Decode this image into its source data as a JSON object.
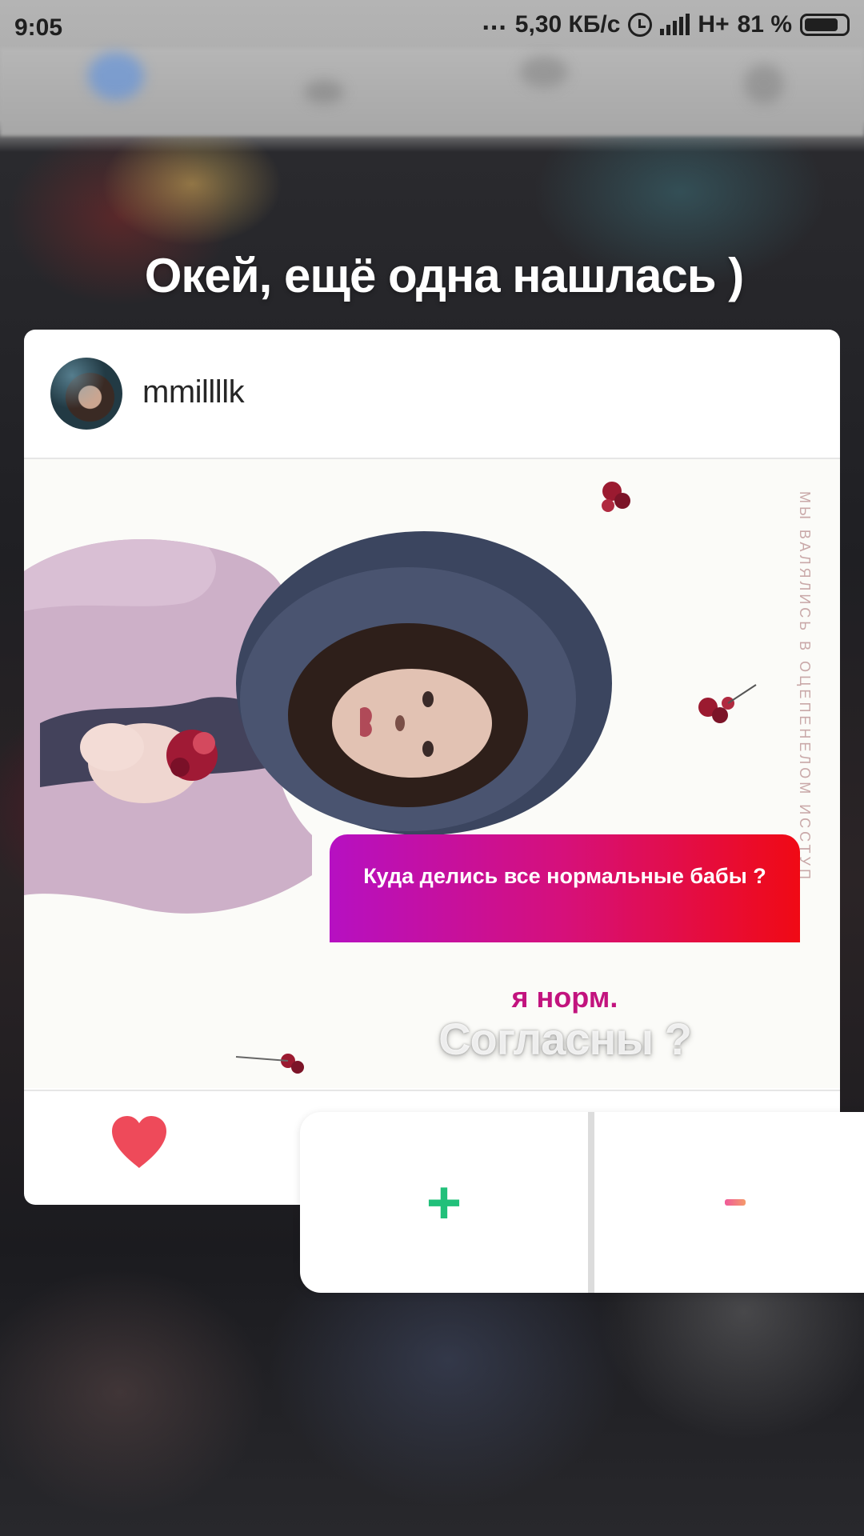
{
  "status_bar": {
    "time": "9:05",
    "dots": "...",
    "speed": "5,30 КБ/с",
    "network": "H+",
    "battery": "81 %"
  },
  "headline": "Окей, ещё одна нашлась )",
  "post": {
    "username": "mmillllk",
    "photo_caption_text": "МЫ ВАЛЯЛИСЬ В ОЦЕПЕНЕЛОМ ИССТУП",
    "liked": true
  },
  "poll": {
    "question": "Куда делись все нормальные бабы ?",
    "answer": "я норм.",
    "prompt": "Согласны ?"
  },
  "vote": {
    "plus_label": "+",
    "minus_label": "-"
  },
  "colors": {
    "accent_plus": "#21c07a",
    "like": "#ee4a5a",
    "gradient_start": "#b610c2",
    "gradient_end": "#f00a14"
  },
  "icons": {
    "alarm": "alarm-icon",
    "signal": "signal-icon",
    "battery": "battery-icon",
    "like": "heart-icon"
  }
}
